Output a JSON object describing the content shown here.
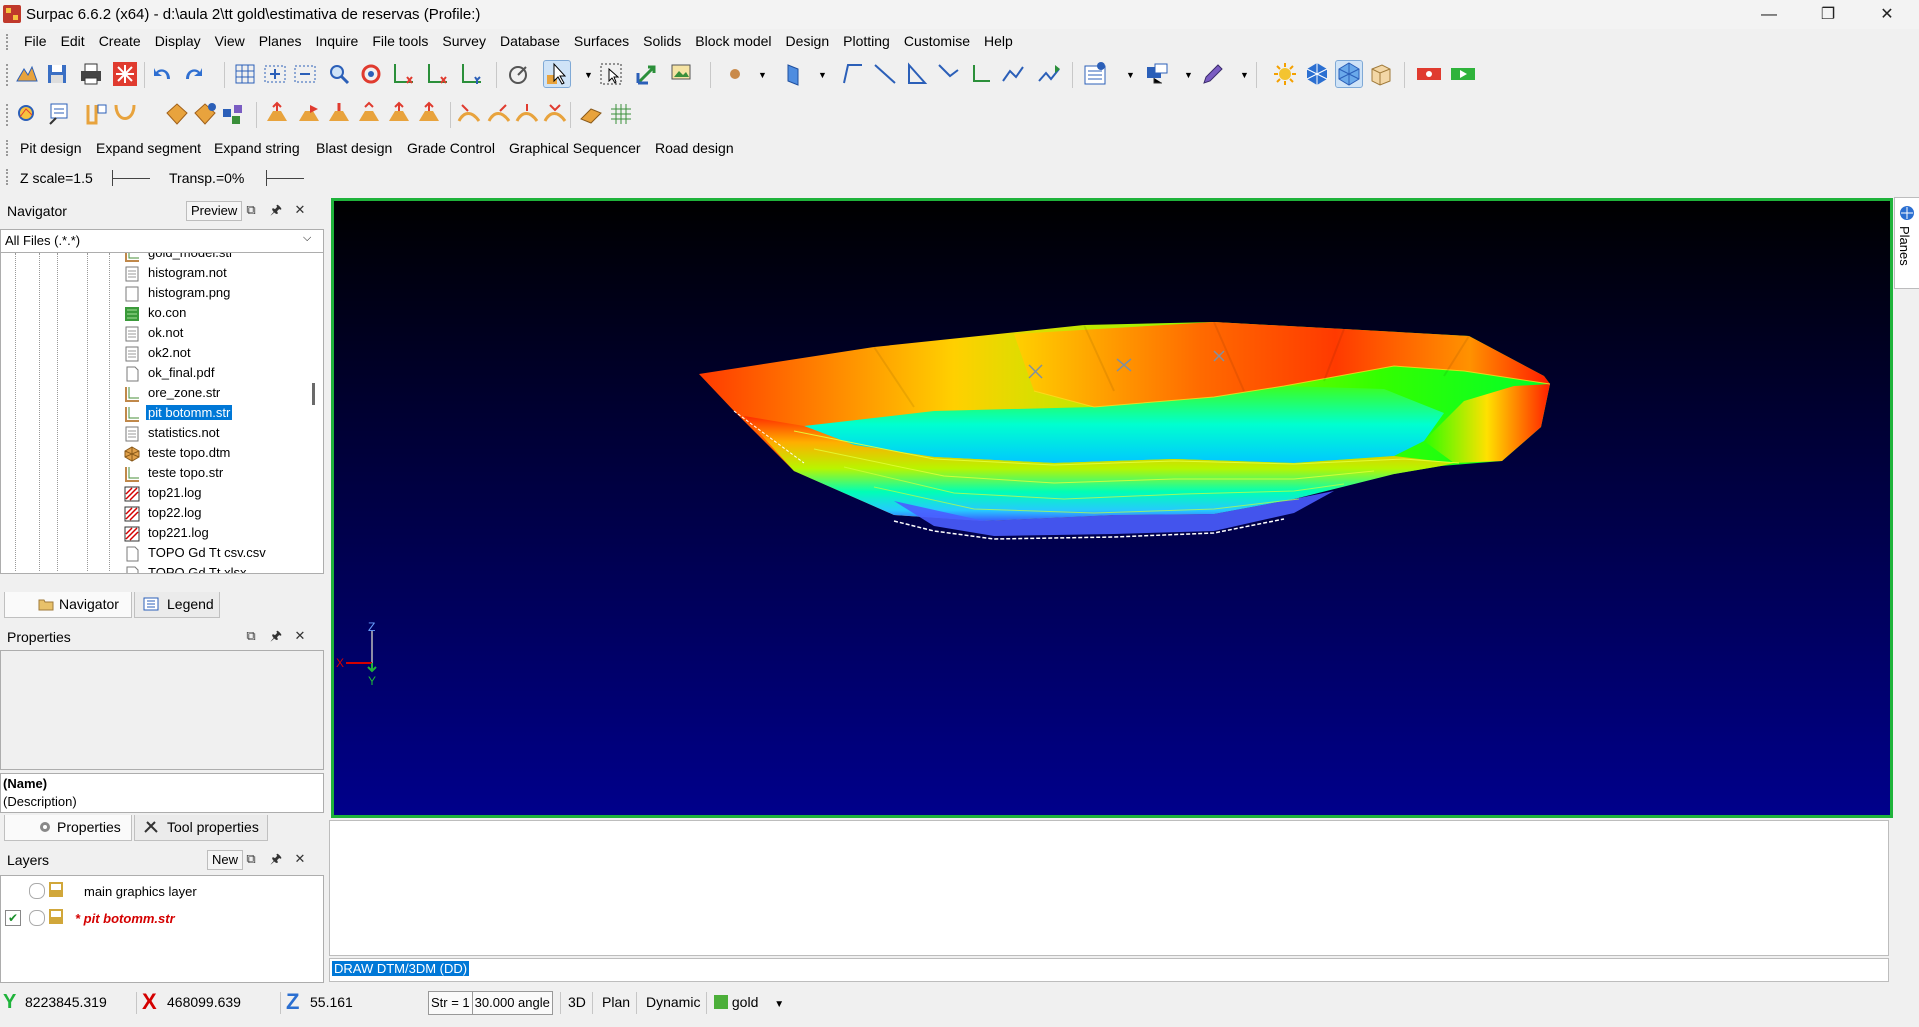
{
  "window": {
    "title": "Surpac 6.6.2 (x64) - d:\\aula 2\\tt gold\\estimativa de reservas (Profile:)",
    "controls": [
      "minimize",
      "restore",
      "close"
    ]
  },
  "menu": [
    "File",
    "Edit",
    "Create",
    "Display",
    "View",
    "Planes",
    "Inquire",
    "File tools",
    "Survey",
    "Database",
    "Surfaces",
    "Solids",
    "Block model",
    "Design",
    "Plotting",
    "Customise",
    "Help"
  ],
  "toolbar_text": {
    "items": [
      "Pit design",
      "Expand segment",
      "Expand string",
      "Blast design",
      "Grade Control",
      "Graphical Sequencer",
      "Road design"
    ]
  },
  "scale_toolbar": {
    "z_scale": "Z scale=1.5",
    "transparency": "Transp.=0%"
  },
  "navigator": {
    "title": "Navigator",
    "preview_label": "Preview",
    "filter": "All Files (.*.*)",
    "files": [
      {
        "name": "gold_model.str",
        "icon": "string-file-icon"
      },
      {
        "name": "histogram.not",
        "icon": "note-file-icon"
      },
      {
        "name": "histogram.png",
        "icon": "image-file-icon"
      },
      {
        "name": "ko.con",
        "icon": "constraint-file-icon"
      },
      {
        "name": "ok.not",
        "icon": "note-file-icon"
      },
      {
        "name": "ok2.not",
        "icon": "note-file-icon"
      },
      {
        "name": "ok_final.pdf",
        "icon": "document-file-icon"
      },
      {
        "name": "ore_zone.str",
        "icon": "string-file-icon"
      },
      {
        "name": "pit botomm.str",
        "icon": "string-file-icon",
        "selected": true
      },
      {
        "name": "statistics.not",
        "icon": "note-file-icon"
      },
      {
        "name": "teste topo.dtm",
        "icon": "dtm-file-icon"
      },
      {
        "name": "teste topo.str",
        "icon": "string-file-icon"
      },
      {
        "name": "top21.log",
        "icon": "log-file-icon"
      },
      {
        "name": "top22.log",
        "icon": "log-file-icon"
      },
      {
        "name": "top221.log",
        "icon": "log-file-icon"
      },
      {
        "name": "TOPO Gd Tt csv.csv",
        "icon": "document-file-icon"
      },
      {
        "name": "TOPO Gd Tt.xlsx",
        "icon": "document-file-icon"
      }
    ],
    "tabs": [
      "Navigator",
      "Legend"
    ]
  },
  "properties": {
    "title": "Properties",
    "name_label": "(Name)",
    "description_label": "(Description)",
    "tabs": [
      "Properties",
      "Tool properties"
    ]
  },
  "layers": {
    "title": "Layers",
    "new_label": "New",
    "items": [
      {
        "name": "main graphics layer",
        "checked": false,
        "active": false
      },
      {
        "name": "* pit botomm.str",
        "checked": true,
        "active": true
      }
    ]
  },
  "viewport": {
    "axis_labels": {
      "z": "Z",
      "x": "X",
      "y": "Y"
    },
    "background_top": "#000000",
    "background_bottom": "#00008b",
    "side_tab": "Planes"
  },
  "command_line": "DRAW DTM/3DM (DD)",
  "status_bar": {
    "y": "8223845.319",
    "x": "468099.639",
    "z": "55.161",
    "str": "Str = 1",
    "angle": "30.000 angle",
    "btn_3d": "3D",
    "btn_plan": "Plan",
    "btn_dynamic": "Dynamic",
    "layer": "gold"
  },
  "colors": {
    "accent": "#0078d7",
    "viewport_border": "#1fb33b",
    "active_layer": "#d40000"
  }
}
